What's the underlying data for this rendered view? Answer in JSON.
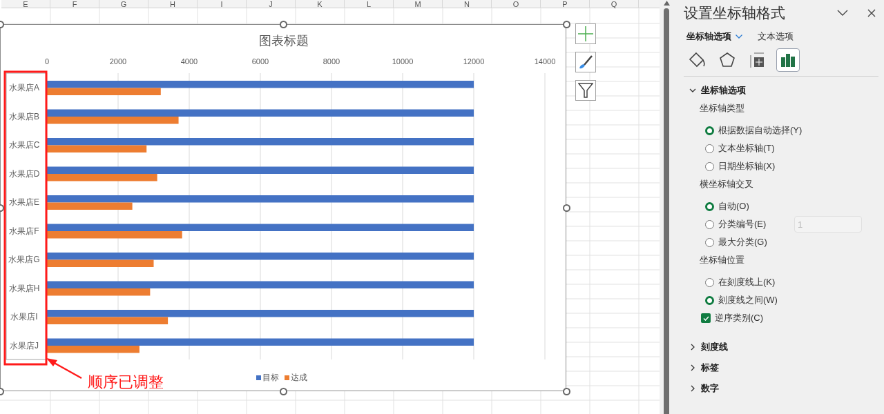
{
  "sheet": {
    "columns": [
      "E",
      "F",
      "G",
      "H",
      "I",
      "J",
      "K",
      "L",
      "M",
      "N",
      "O",
      "P",
      "Q"
    ]
  },
  "chart": {
    "chart_data": {
      "type": "bar",
      "orientation": "horizontal",
      "title": "图表标题",
      "categories": [
        "水果店A",
        "水果店B",
        "水果店C",
        "水果店D",
        "水果店E",
        "水果店F",
        "水果店G",
        "水果店H",
        "水果店I",
        "水果店J"
      ],
      "series": [
        {
          "name": "目标",
          "color": "#4472c4",
          "values": [
            12000,
            12000,
            12000,
            12000,
            12000,
            12000,
            12000,
            12000,
            12000,
            12000
          ]
        },
        {
          "name": "达成",
          "color": "#ed7d31",
          "values": [
            3200,
            3700,
            2800,
            3100,
            2400,
            3800,
            3000,
            2900,
            3400,
            2600
          ]
        }
      ],
      "xlim": [
        0,
        14000
      ],
      "xticks": [
        0,
        2000,
        4000,
        6000,
        8000,
        10000,
        12000,
        14000
      ],
      "grid": true,
      "legend": true
    },
    "annotation": "顺序已调整"
  },
  "panel": {
    "title": "设置坐标轴格式",
    "tabs": [
      {
        "label": "坐标轴选项",
        "selected": true
      },
      {
        "label": "文本选项",
        "selected": false
      }
    ],
    "icon_tabs": [
      {
        "kind": "fill",
        "selected": false
      },
      {
        "kind": "effects",
        "selected": false
      },
      {
        "kind": "size",
        "selected": false
      },
      {
        "kind": "axis",
        "selected": true
      }
    ],
    "sections": [
      {
        "title": "坐标轴选项",
        "expanded": true,
        "items": [
          {
            "kind": "heading",
            "label": "坐标轴类型"
          },
          {
            "kind": "radio",
            "label": "根据数据自动选择(Y)",
            "selected": true
          },
          {
            "kind": "radio",
            "label": "文本坐标轴(T)",
            "selected": false
          },
          {
            "kind": "radio",
            "label": "日期坐标轴(X)",
            "selected": false
          },
          {
            "kind": "heading",
            "label": "横坐标轴交叉"
          },
          {
            "kind": "radio",
            "label": "自动(O)",
            "selected": true
          },
          {
            "kind": "radio",
            "label": "分类编号(E)",
            "selected": false,
            "field": {
              "value": "1",
              "disabled": true
            }
          },
          {
            "kind": "radio",
            "label": "最大分类(G)",
            "selected": false
          },
          {
            "kind": "heading",
            "label": "坐标轴位置"
          },
          {
            "kind": "radio",
            "label": "在刻度线上(K)",
            "selected": false
          },
          {
            "kind": "radio",
            "label": "刻度线之间(W)",
            "selected": true
          },
          {
            "kind": "checkbox",
            "label": "逆序类别(C)",
            "checked": true
          }
        ]
      },
      {
        "title": "刻度线",
        "expanded": false
      },
      {
        "title": "标签",
        "expanded": false
      },
      {
        "title": "数字",
        "expanded": false
      }
    ]
  }
}
